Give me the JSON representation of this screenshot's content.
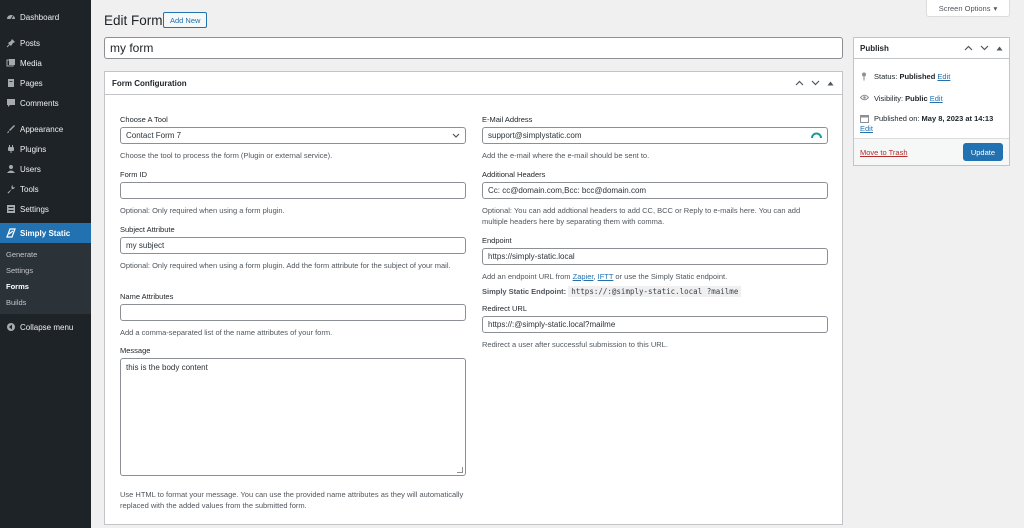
{
  "sidebar": {
    "items": [
      {
        "label": "Dashboard",
        "icon": "dashboard-icon"
      },
      {
        "label": "Posts",
        "icon": "pin-icon"
      },
      {
        "label": "Media",
        "icon": "media-icon"
      },
      {
        "label": "Pages",
        "icon": "page-icon"
      },
      {
        "label": "Comments",
        "icon": "comment-icon"
      },
      {
        "label": "Appearance",
        "icon": "brush-icon"
      },
      {
        "label": "Plugins",
        "icon": "plugin-icon"
      },
      {
        "label": "Users",
        "icon": "user-icon"
      },
      {
        "label": "Tools",
        "icon": "wrench-icon"
      },
      {
        "label": "Settings",
        "icon": "settings-icon"
      }
    ],
    "active": "Simply Static",
    "submenu": [
      "Generate",
      "Settings",
      "Forms",
      "Builds"
    ],
    "collapse": "Collapse menu"
  },
  "header": {
    "screen_options": "Screen Options",
    "title": "Edit Form",
    "add_new": "Add New",
    "form_title": "my form"
  },
  "config": {
    "heading": "Form Configuration",
    "tool": {
      "label": "Choose A Tool",
      "value": "Contact Form 7",
      "desc": "Choose the tool to process the form (Plugin or external service)."
    },
    "form_id": {
      "label": "Form ID",
      "value": "",
      "desc": "Optional: Only required when using a form plugin."
    },
    "subject": {
      "label": "Subject Attribute",
      "value": "my subject",
      "desc": "Optional: Only required when using a form plugin. Add the form attribute for the subject of your mail."
    },
    "names": {
      "label": "Name Attributes",
      "value": "",
      "desc": "Add a comma-separated list of the name attributes of your form."
    },
    "message": {
      "label": "Message",
      "value": "this is the body content",
      "desc": "Use HTML to format your message. You can use the provided name attributes as they will automatically replaced with the added values from the submitted form."
    },
    "email": {
      "label": "E-Mail Address",
      "value": "support@simplystatic.com",
      "desc": "Add the e-mail where the e-mail should be sent to."
    },
    "headers": {
      "label": "Additional Headers",
      "value": "Cc: cc@domain.com,Bcc: bcc@domain.com",
      "desc": "Optional: You can add addtional headers to add CC, BCC or Reply to e-mails here. You can add multiple headers here by separating them with comma."
    },
    "endpoint": {
      "label": "Endpoint",
      "value": "https://simply-static.local",
      "desc_pre": "Add an endpoint URL from ",
      "link1": "Zapier",
      "desc_mid": ", ",
      "link2": "IFTT",
      "desc_post": " or use the Simply Static endpoint.",
      "ss_label": "Simply Static Endpoint:",
      "ss_value": "https://:@simply-static.local ?mailme"
    },
    "redirect": {
      "label": "Redirect URL",
      "value": "https://:@simply-static.local?mailme",
      "desc": "Redirect a user after successful submission to this URL."
    }
  },
  "publish": {
    "heading": "Publish",
    "status_label": "Status:",
    "status_value": "Published",
    "visibility_label": "Visibility:",
    "visibility_value": "Public",
    "published_label": "Published on:",
    "published_value": "May 8, 2023 at 14:13",
    "edit": "Edit",
    "trash": "Move to Trash",
    "update": "Update"
  },
  "colors": {
    "accent": "#2271b1",
    "sidebar_bg": "#1d2327",
    "danger": "#b32d2e"
  }
}
